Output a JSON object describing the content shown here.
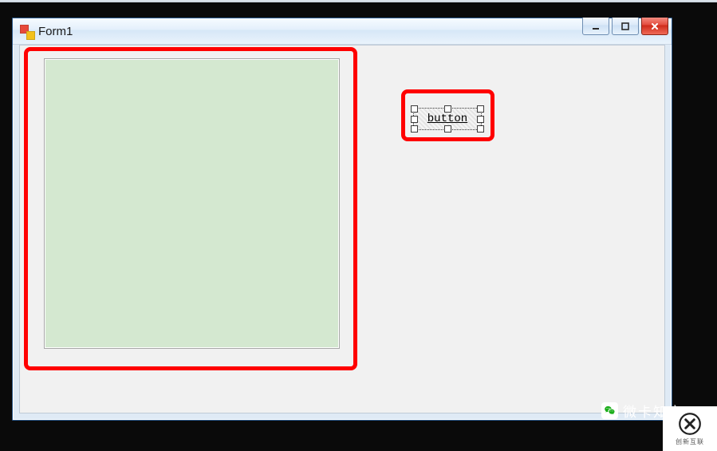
{
  "window": {
    "title": "Form1"
  },
  "panel": {
    "bg_color": "#d4e8d0"
  },
  "button": {
    "label": "button"
  },
  "watermark": {
    "wechat_label": "微卡知享",
    "corner_label": "创新互联"
  }
}
